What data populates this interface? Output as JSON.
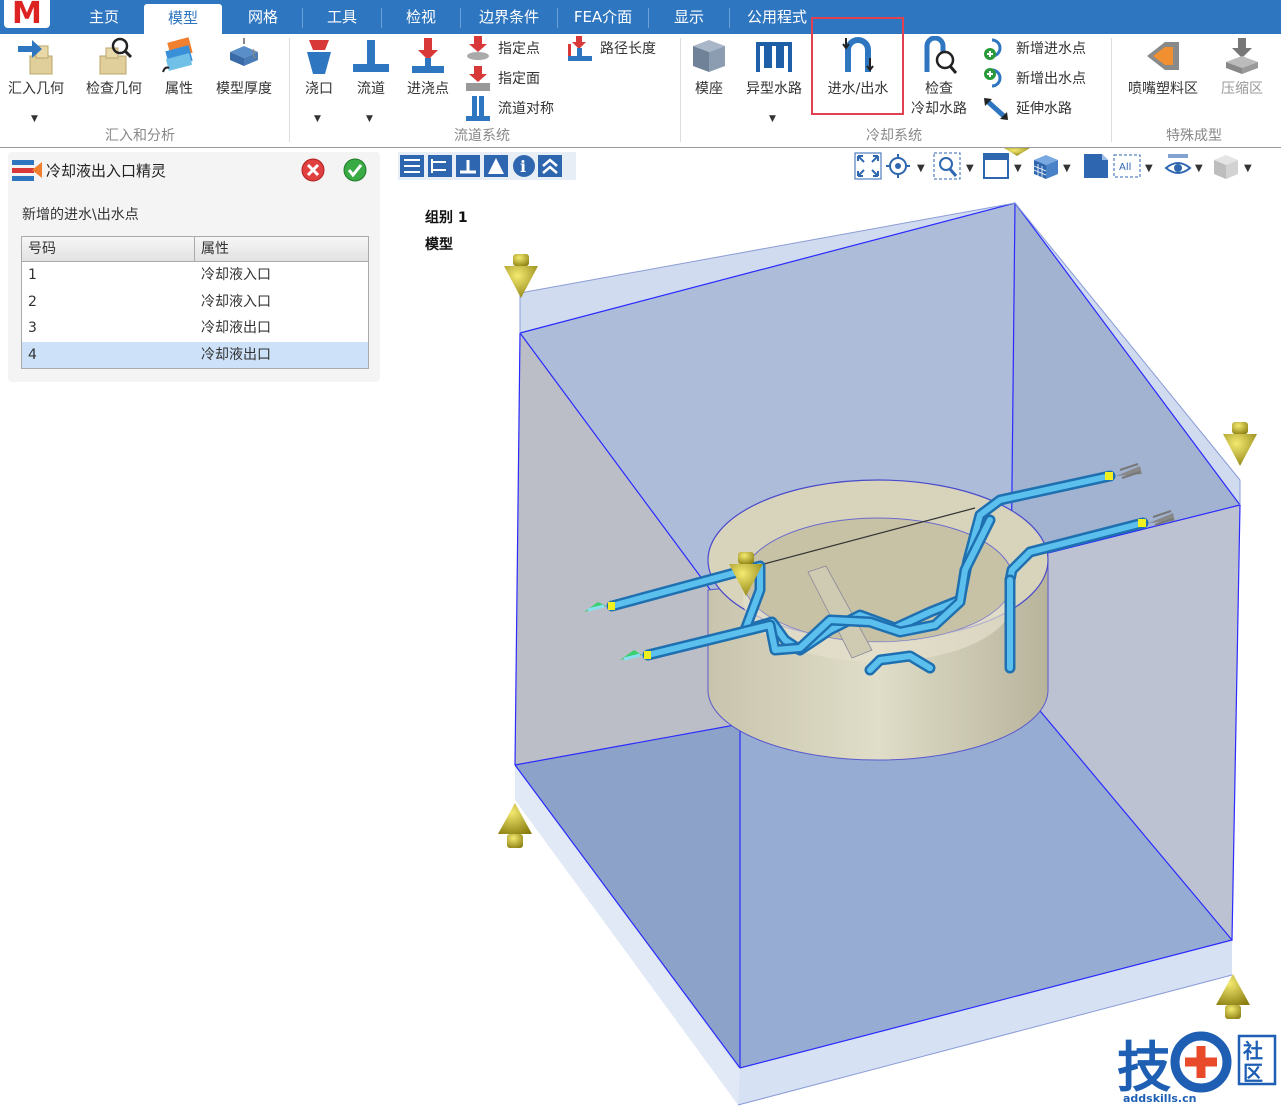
{
  "logo": "M",
  "tabs": [
    {
      "label": "主页"
    },
    {
      "label": "模型"
    },
    {
      "label": "网格"
    },
    {
      "label": "工具"
    },
    {
      "label": "检视"
    },
    {
      "label": "边界条件"
    },
    {
      "label": "FEA介面"
    },
    {
      "label": "显示"
    },
    {
      "label": "公用程式"
    }
  ],
  "ribbon": {
    "import": {
      "import_geometry": "汇入几何",
      "check_geometry": "检查几何",
      "properties": "属性",
      "model_thickness": "模型厚度",
      "group": "汇入和分析"
    },
    "runner": {
      "gate": "浇口",
      "runner": "流道",
      "injection_point": "进浇点",
      "specify_point": "指定点",
      "specify_face": "指定面",
      "runner_symmetry": "流道对称",
      "path_length": "路径长度",
      "group": "流道系统"
    },
    "cooling": {
      "mold_base": "模座",
      "special_channel": "异型水路",
      "inlet_outlet": "进水/出水",
      "check_line1": "检查",
      "check_line2": "冷却水路",
      "add_inlet": "新增进水点",
      "add_outlet": "新增出水点",
      "extend_channel": "延伸水路",
      "group": "冷却系统"
    },
    "special": {
      "nozzle_region": "喷嘴塑料区",
      "compression_region": "压缩区",
      "group": "特殊成型"
    }
  },
  "wizard": {
    "title": "冷却液出入口精灵",
    "subtitle": "新增的进水\\出水点",
    "columns": [
      "号码",
      "属性"
    ],
    "rows": [
      {
        "id": "1",
        "attr": "冷却液入口"
      },
      {
        "id": "2",
        "attr": "冷却液入口"
      },
      {
        "id": "3",
        "attr": "冷却液出口"
      },
      {
        "id": "4",
        "attr": "冷却液出口"
      }
    ],
    "selected_row": 4
  },
  "viewport": {
    "group_label": "组别 1",
    "model_label": "模型",
    "all_label": "All"
  },
  "watermark": {
    "char1": "技",
    "char2": "社",
    "char3": "区",
    "url": "addskills.cn"
  },
  "colors": {
    "tab_bar": "#2f76c0",
    "highlight": "#e04050",
    "mold_fill": "#a8b9d6",
    "mold_edge": "#1a1aff",
    "channel": "#3aa0d8",
    "insert": "#d8d4be",
    "gate_marker": "#b5a818"
  }
}
